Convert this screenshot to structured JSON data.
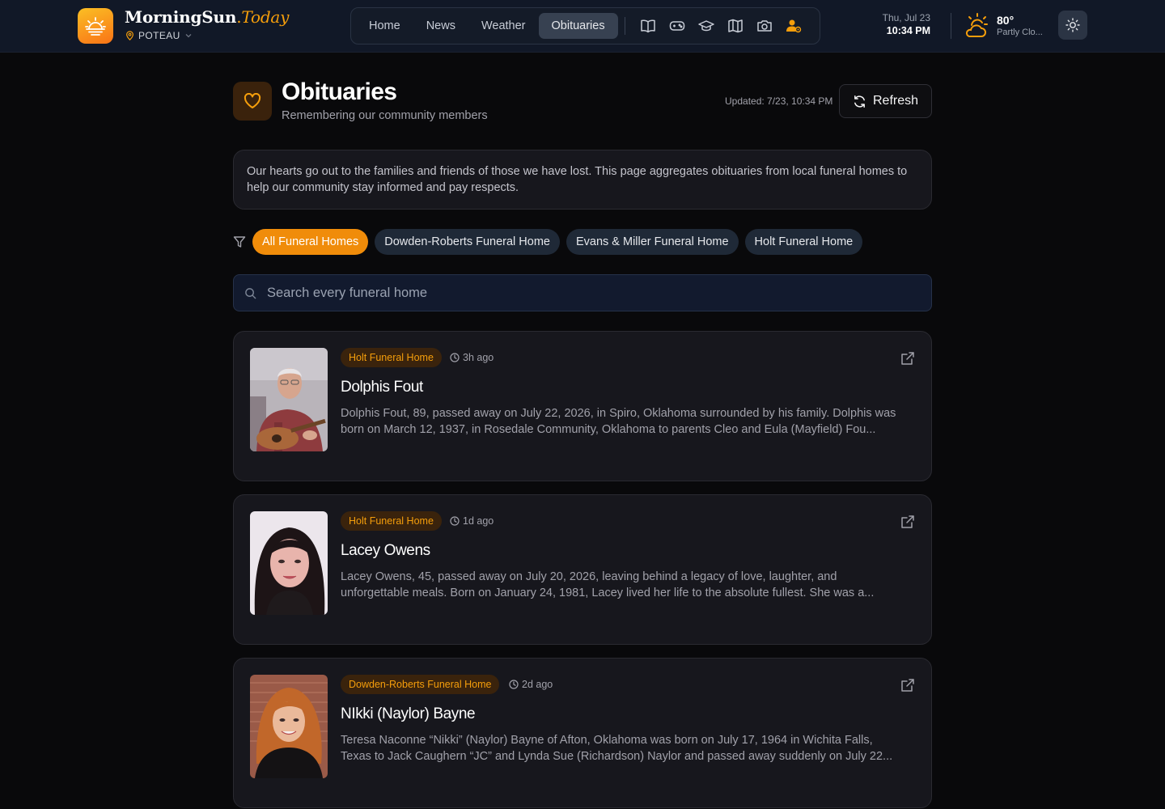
{
  "header": {
    "brand_name": "MorningSun",
    "brand_dot": ".",
    "brand_suffix": "Today",
    "location": "POTEAU",
    "nav": [
      {
        "label": "Home",
        "active": false
      },
      {
        "label": "News",
        "active": false
      },
      {
        "label": "Weather",
        "active": false
      },
      {
        "label": "Obituaries",
        "active": true
      }
    ],
    "nav_icons": [
      "book-icon",
      "gamepad-icon",
      "graduation-cap-icon",
      "map-icon",
      "camera-icon",
      "user-settings-icon"
    ],
    "date": "Thu, Jul 23",
    "time": "10:34 PM",
    "weather": {
      "temp": "80°",
      "condition": "Partly Clo..."
    }
  },
  "page": {
    "title": "Obituaries",
    "subtitle": "Remembering our community members",
    "updated": "Updated: 7/23, 10:34 PM",
    "refresh_label": "Refresh",
    "notice": "Our hearts go out to the families and friends of those we have lost. This page aggregates obituaries from local funeral homes to help our community stay informed and pay respects."
  },
  "filters": [
    {
      "label": "All Funeral Homes",
      "active": true
    },
    {
      "label": "Dowden-Roberts Funeral Home",
      "active": false
    },
    {
      "label": "Evans & Miller Funeral Home",
      "active": false
    },
    {
      "label": "Holt Funeral Home",
      "active": false
    }
  ],
  "search": {
    "placeholder": "Search every funeral home",
    "value": ""
  },
  "obituaries": [
    {
      "funeral_home": "Holt Funeral Home",
      "ago": "3h ago",
      "name": "Dolphis Fout",
      "excerpt": "Dolphis Fout, 89, passed away on July 22, 2026, in Spiro, Oklahoma surrounded by his family. Dolphis was born on March 12, 1937, in Rosedale Community, Oklahoma to parents Cleo and Eula (Mayfield) Fou..."
    },
    {
      "funeral_home": "Holt Funeral Home",
      "ago": "1d ago",
      "name": "Lacey Owens",
      "excerpt": "Lacey Owens, 45, passed away on July 20, 2026, leaving behind a legacy of love, laughter, and unforgettable meals. Born on January 24, 1981, Lacey lived her life to the absolute fullest. She was a..."
    },
    {
      "funeral_home": "Dowden-Roberts Funeral Home",
      "ago": "2d ago",
      "name": "NIkki (Naylor) Bayne",
      "excerpt": "Teresa Naconne “Nikki” (Naylor) Bayne of Afton, Oklahoma was born on July 17, 1964 in Wichita Falls, Texas to Jack Caughern “JC” and Lynda Sue (Richardson) Naylor and passed away suddenly on July 22..."
    }
  ],
  "colors": {
    "accent": "#f59e0b",
    "background": "#09090b",
    "card": "#17171d",
    "header": "#111827"
  }
}
